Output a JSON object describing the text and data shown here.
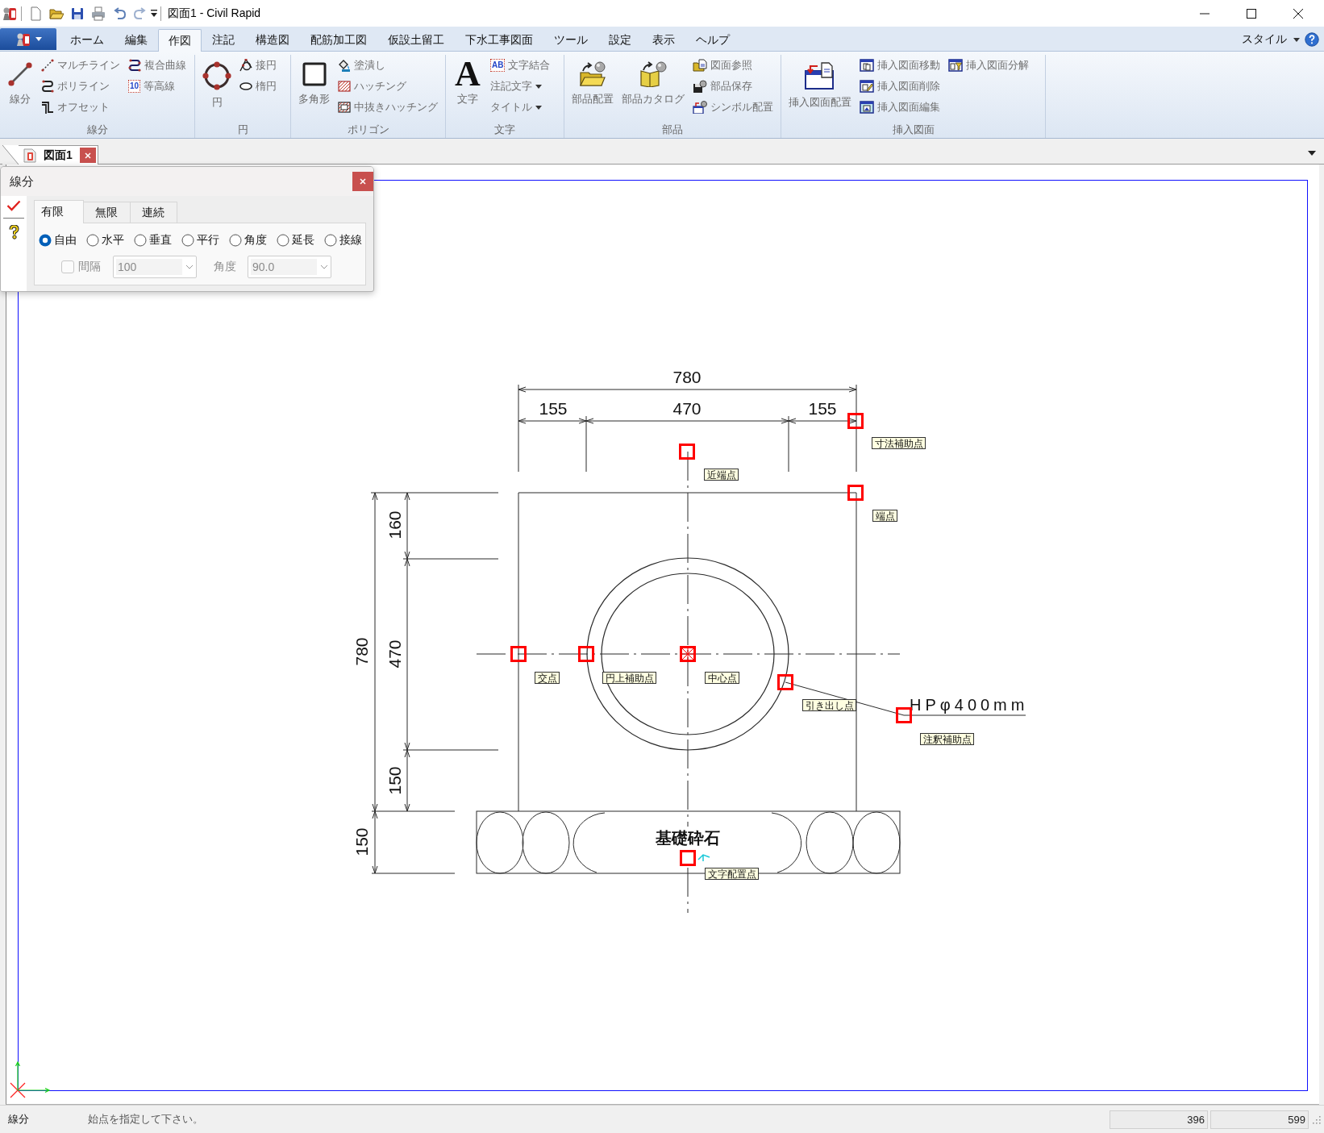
{
  "window": {
    "title": "図面1 - Civil Rapid"
  },
  "menu_tabs": [
    {
      "label": "ホーム",
      "selected": false
    },
    {
      "label": "編集",
      "selected": false
    },
    {
      "label": "作図",
      "selected": true
    },
    {
      "label": "注記",
      "selected": false
    },
    {
      "label": "構造図",
      "selected": false
    },
    {
      "label": "配筋加工図",
      "selected": false
    },
    {
      "label": "仮設土留工",
      "selected": false
    },
    {
      "label": "下水工事図面",
      "selected": false
    },
    {
      "label": "ツール",
      "selected": false
    },
    {
      "label": "設定",
      "selected": false
    },
    {
      "label": "表示",
      "selected": false
    },
    {
      "label": "ヘルプ",
      "selected": false
    }
  ],
  "style_menu": {
    "label": "スタイル"
  },
  "ribbon_groups": [
    {
      "label": "線分",
      "large_buttons": [
        {
          "label": "線分"
        }
      ],
      "small_columns": [
        {
          "buttons": [
            {
              "label": "マルチライン",
              "dropdown": false
            },
            {
              "label": "ポリライン",
              "dropdown": false
            },
            {
              "label": "オフセット",
              "dropdown": false
            }
          ]
        },
        {
          "buttons": [
            {
              "label": "複合曲線",
              "dropdown": false
            },
            {
              "label": "等高線",
              "dropdown": false,
              "glyph": "10"
            }
          ]
        }
      ]
    },
    {
      "label": "円",
      "large_buttons": [
        {
          "label": "円"
        }
      ],
      "small_columns": [
        {
          "buttons": [
            {
              "label": "接円",
              "dropdown": false
            },
            {
              "label": "楕円",
              "dropdown": false
            }
          ]
        }
      ]
    },
    {
      "label": "ポリゴン",
      "large_buttons": [
        {
          "label": "多角形"
        }
      ],
      "small_columns": [
        {
          "buttons": [
            {
              "label": "塗潰し",
              "dropdown": false
            },
            {
              "label": "ハッチング",
              "dropdown": false
            },
            {
              "label": "中抜きハッチング",
              "dropdown": false
            }
          ]
        }
      ]
    },
    {
      "label": "文字",
      "large_buttons": [
        {
          "label": "文字",
          "glyph": "A"
        }
      ],
      "small_columns": [
        {
          "buttons": [
            {
              "label": "文字結合",
              "dropdown": false,
              "glyph": "AB"
            },
            {
              "label": "注記文字",
              "dropdown": true
            },
            {
              "label": "タイトル",
              "dropdown": true
            }
          ]
        }
      ]
    },
    {
      "label": "部品",
      "large_buttons": [
        {
          "label": "部品配置"
        },
        {
          "label": "部品カタログ"
        }
      ],
      "small_columns": [
        {
          "buttons": [
            {
              "label": "図面参照",
              "dropdown": false
            },
            {
              "label": "部品保存",
              "dropdown": false
            },
            {
              "label": "シンボル配置",
              "dropdown": false
            }
          ]
        }
      ]
    },
    {
      "label": "挿入図面",
      "large_buttons": [
        {
          "label": "挿入図面配置"
        }
      ],
      "small_columns": [
        {
          "buttons": [
            {
              "label": "挿入図面移動",
              "dropdown": false
            },
            {
              "label": "挿入図面削除",
              "dropdown": false
            },
            {
              "label": "挿入図面編集",
              "dropdown": false
            }
          ]
        },
        {
          "buttons": [
            {
              "label": "挿入図面分解",
              "dropdown": false
            }
          ]
        }
      ]
    }
  ],
  "document_tabs": [
    {
      "label": "図面1",
      "selected": true
    }
  ],
  "dialog": {
    "title": "線分",
    "tabs": [
      {
        "label": "有限",
        "selected": true
      },
      {
        "label": "無限",
        "selected": false
      },
      {
        "label": "連続",
        "selected": false
      }
    ],
    "modes": [
      {
        "label": "自由",
        "selected": true
      },
      {
        "label": "水平",
        "selected": false
      },
      {
        "label": "垂直",
        "selected": false
      },
      {
        "label": "平行",
        "selected": false
      },
      {
        "label": "角度",
        "selected": false
      },
      {
        "label": "延長",
        "selected": false
      },
      {
        "label": "接線",
        "selected": false
      }
    ],
    "interval": {
      "label": "間隔",
      "checked": false,
      "value": "100",
      "disabled": true
    },
    "angle": {
      "label": "角度",
      "value": "90.0",
      "disabled": true
    }
  },
  "drawing": {
    "horizontal_dimensions": [
      "780",
      "155",
      "470",
      "155"
    ],
    "vertical_dimensions": [
      "160",
      "780",
      "470",
      "150",
      "150"
    ],
    "snap_labels": [
      "寸法補助点",
      "近端点",
      "端点",
      "交点",
      "円上補助点",
      "中心点",
      "引き出し点",
      "注釈補助点",
      "文字配置点"
    ],
    "annotation": "HPφ400mm",
    "fill_label": "基礎砕石"
  },
  "status_bar": {
    "mode": "線分",
    "prompt": "始点を指定して下さい。",
    "readings": [
      "396",
      "599"
    ]
  }
}
